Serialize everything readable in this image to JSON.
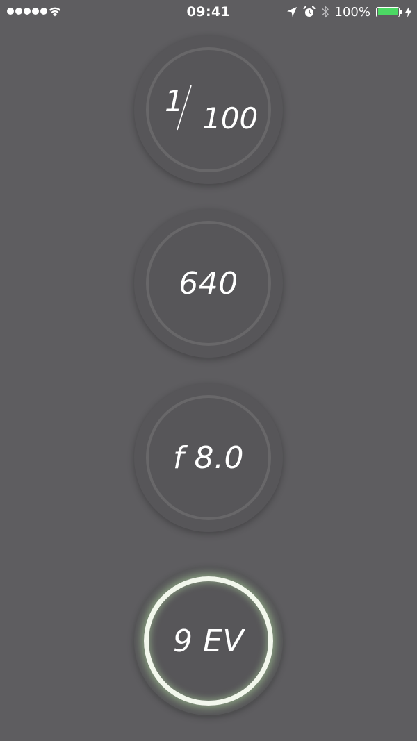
{
  "status_bar": {
    "time": "09:41",
    "battery_percent": "100%",
    "battery_level": 1.0,
    "battery_color": "#4cd964",
    "signal_bars": 5,
    "icons": [
      "signal-dots-icon",
      "wifi-icon",
      "location-arrow-icon",
      "alarm-icon",
      "bluetooth-icon",
      "battery-icon",
      "charging-bolt-icon"
    ]
  },
  "dials": {
    "shutter": {
      "numerator": "1",
      "denominator": "100"
    },
    "iso": {
      "value": "640"
    },
    "aperture": {
      "value": "f 8.0"
    },
    "exposure": {
      "value": "9 EV",
      "active": true,
      "glow_color": "#f2f7ec"
    }
  },
  "colors": {
    "background": "#5e5d60",
    "dial": "#575659",
    "ring": "#686769"
  }
}
